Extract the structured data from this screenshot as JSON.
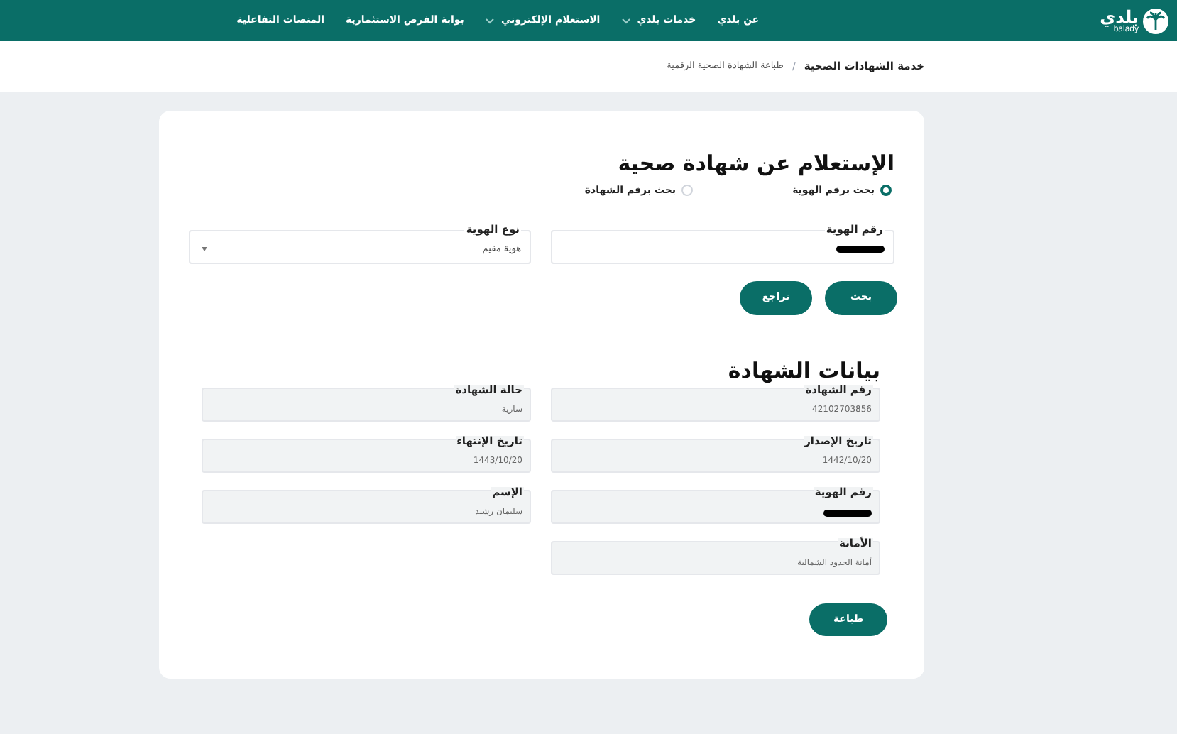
{
  "nav": {
    "logo": {
      "text": "بلدي",
      "subtext": "balady"
    },
    "items": [
      {
        "label": "عن بلدي",
        "dropdown": false
      },
      {
        "label": "خدمات بلدي",
        "dropdown": true
      },
      {
        "label": "الاستعلام الإلكتروني",
        "dropdown": true
      },
      {
        "label": "بوابة الفرص الاستثمارية",
        "dropdown": false
      },
      {
        "label": "المنصات التفاعلية",
        "dropdown": false
      }
    ]
  },
  "breadcrumb_separator": "/",
  "breadcrumb": [
    {
      "label": "خدمة الشهادات الصحية",
      "current": false
    },
    {
      "label": "طباعة الشهادة الصحية الرقمية",
      "current": true
    }
  ],
  "search": {
    "title": "الإستعلام عن شهادة صحية",
    "radios": [
      {
        "label": "بحث برقم الهوية",
        "selected": true
      },
      {
        "label": "بحث برقم الشهادة",
        "selected": false
      }
    ],
    "id_field": {
      "label": "رقم الهوية",
      "redacted": true
    },
    "id_type": {
      "label": "نوع الهوية",
      "value": "هوية مقيم"
    },
    "buttons": [
      {
        "label": "بحث"
      },
      {
        "label": "تراجع"
      }
    ]
  },
  "certificate": {
    "title": "بيانات الشهادة",
    "fields": [
      {
        "label": "رقم الشهادة",
        "value": "42102703856",
        "redacted": false
      },
      {
        "label": "حالة الشهادة",
        "value": "سارية",
        "redacted": false
      },
      {
        "label": "تاريخ الإصدار",
        "value": "1442/10/20",
        "redacted": false
      },
      {
        "label": "تاريخ الإنتهاء",
        "value": "1443/10/20",
        "redacted": false
      },
      {
        "label": "رقم الهوية",
        "redacted": true
      },
      {
        "label": "الإسم",
        "value": "سليمان رشيد",
        "redacted": false
      },
      {
        "label": "الأمانة",
        "value": "أمانة الحدود الشمالية",
        "redacted": false
      }
    ],
    "print_button": "طباعة"
  }
}
